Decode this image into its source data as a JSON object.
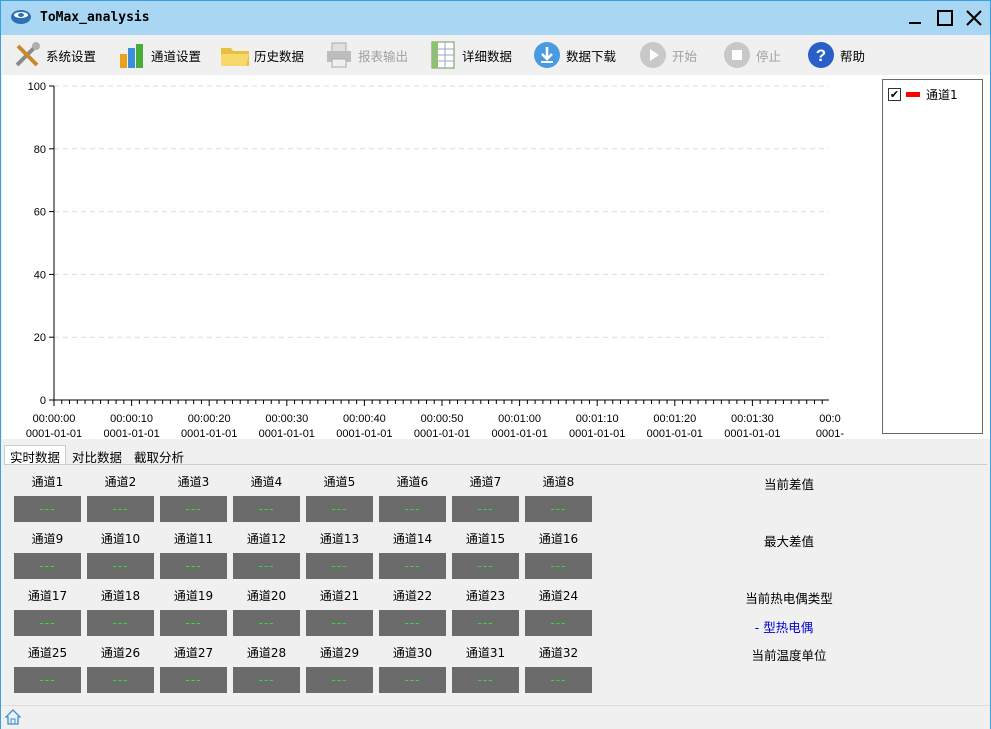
{
  "window": {
    "title": "ToMax_analysis"
  },
  "toolbar": {
    "items": [
      {
        "label": "系统设置",
        "icon": "tools-icon",
        "enabled": true
      },
      {
        "label": "通道设置",
        "icon": "bar-chart-icon",
        "enabled": true
      },
      {
        "label": "历史数据",
        "icon": "folder-icon",
        "enabled": true
      },
      {
        "label": "报表输出",
        "icon": "printer-icon",
        "enabled": false
      },
      {
        "label": "详细数据",
        "icon": "spreadsheet-icon",
        "enabled": true
      },
      {
        "label": "数据下载",
        "icon": "download-icon",
        "enabled": true
      },
      {
        "label": "开始",
        "icon": "play-icon",
        "enabled": false
      },
      {
        "label": "停止",
        "icon": "stop-icon",
        "enabled": false
      },
      {
        "label": "帮助",
        "icon": "help-icon",
        "enabled": true
      }
    ]
  },
  "chart_data": {
    "type": "line",
    "ylim": [
      0,
      100
    ],
    "yticks": [
      "0",
      "20",
      "40",
      "60",
      "80",
      "100"
    ],
    "xticks": [
      {
        "time": "00:00:00",
        "date": "0001-01-01"
      },
      {
        "time": "00:00:10",
        "date": "0001-01-01"
      },
      {
        "time": "00:00:20",
        "date": "0001-01-01"
      },
      {
        "time": "00:00:30",
        "date": "0001-01-01"
      },
      {
        "time": "00:00:40",
        "date": "0001-01-01"
      },
      {
        "time": "00:00:50",
        "date": "0001-01-01"
      },
      {
        "time": "00:01:00",
        "date": "0001-01-01"
      },
      {
        "time": "00:01:10",
        "date": "0001-01-01"
      },
      {
        "time": "00:01:20",
        "date": "0001-01-01"
      },
      {
        "time": "00:01:30",
        "date": "0001-01-01"
      },
      {
        "time": "00:0",
        "date": "0001-"
      }
    ],
    "grid": true,
    "series": [
      {
        "name": "通道1",
        "color": "#ff0000",
        "values": []
      }
    ]
  },
  "legend": {
    "items": [
      {
        "label": "通道1",
        "checked": true,
        "color": "#ff0000"
      }
    ]
  },
  "tabs": [
    "实时数据",
    "对比数据",
    "截取分析"
  ],
  "active_tab": "实时数据",
  "channels": [
    {
      "label": "通道1",
      "value": "---"
    },
    {
      "label": "通道2",
      "value": "---"
    },
    {
      "label": "通道3",
      "value": "---"
    },
    {
      "label": "通道4",
      "value": "---"
    },
    {
      "label": "通道5",
      "value": "---"
    },
    {
      "label": "通道6",
      "value": "---"
    },
    {
      "label": "通道7",
      "value": "---"
    },
    {
      "label": "通道8",
      "value": "---"
    },
    {
      "label": "通道9",
      "value": "---"
    },
    {
      "label": "通道10",
      "value": "---"
    },
    {
      "label": "通道11",
      "value": "---"
    },
    {
      "label": "通道12",
      "value": "---"
    },
    {
      "label": "通道13",
      "value": "---"
    },
    {
      "label": "通道14",
      "value": "---"
    },
    {
      "label": "通道15",
      "value": "---"
    },
    {
      "label": "通道16",
      "value": "---"
    },
    {
      "label": "通道17",
      "value": "---"
    },
    {
      "label": "通道18",
      "value": "---"
    },
    {
      "label": "通道19",
      "value": "---"
    },
    {
      "label": "通道20",
      "value": "---"
    },
    {
      "label": "通道21",
      "value": "---"
    },
    {
      "label": "通道22",
      "value": "---"
    },
    {
      "label": "通道23",
      "value": "---"
    },
    {
      "label": "通道24",
      "value": "---"
    },
    {
      "label": "通道25",
      "value": "---"
    },
    {
      "label": "通道26",
      "value": "---"
    },
    {
      "label": "通道27",
      "value": "---"
    },
    {
      "label": "通道28",
      "value": "---"
    },
    {
      "label": "通道29",
      "value": "---"
    },
    {
      "label": "通道30",
      "value": "---"
    },
    {
      "label": "通道31",
      "value": "---"
    },
    {
      "label": "通道32",
      "value": "---"
    }
  ],
  "summary": {
    "current_diff_label": "当前差值",
    "max_diff_label": "最大差值",
    "couple_type_label": "当前热电偶类型",
    "couple_type_value": "- 型热电偶",
    "temp_unit_label": "当前温度单位"
  }
}
